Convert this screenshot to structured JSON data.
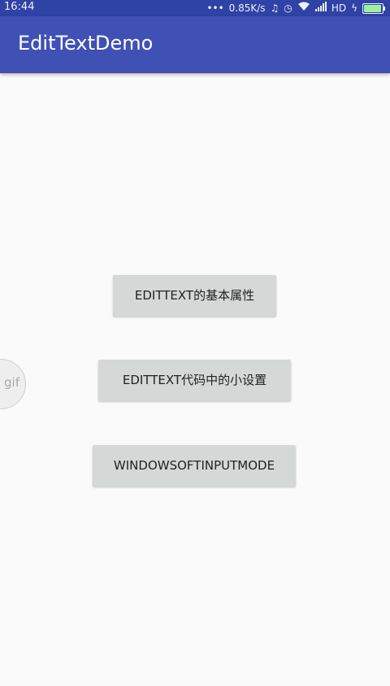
{
  "status_bar": {
    "time": "16:44",
    "dots": "•••",
    "network_speed": "0.85K/s",
    "icons": [
      "music-icon",
      "alarm-icon",
      "wifi-icon",
      "signal-icon"
    ],
    "network_type": "HD",
    "charging_symbol": "ϟ",
    "battery_level": 0.95,
    "battery_color": "#9cf29c"
  },
  "app_bar": {
    "title": "EditTextDemo",
    "color": "#3f51b5"
  },
  "buttons": [
    {
      "label": "EDITTEXT的基本属性"
    },
    {
      "label": "EDITTEXT代码中的小设置"
    },
    {
      "label": "WINDOWSOFTINPUTMODE"
    }
  ],
  "overlay": {
    "gif_label": "gif"
  }
}
